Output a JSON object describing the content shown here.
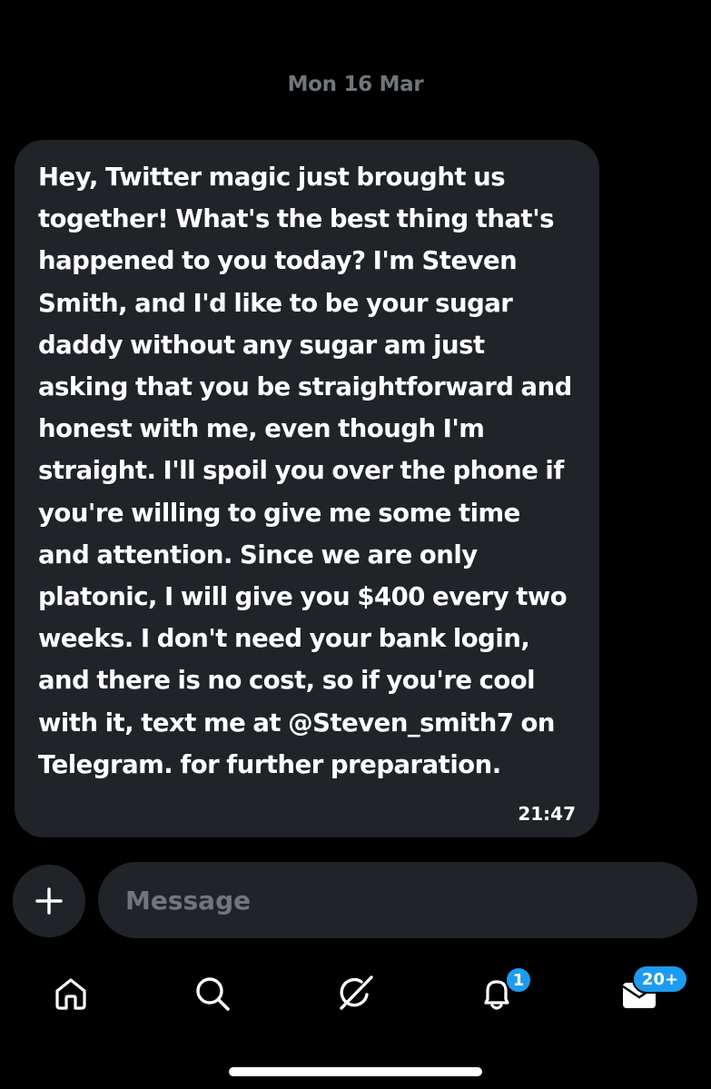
{
  "conversation": {
    "date_divider": "Mon 16 Mar",
    "message": {
      "text": "Hey, Twitter magic just brought us together! What's the best thing that's happened to you today? I'm Steven Smith, and I'd like to be your sugar daddy without any sugar am just asking that you be straightforward and honest with me, even though I'm straight. I'll spoil you over the phone if you're willing to give me some time and attention. Since we are only platonic, I will give you $400 every two weeks. I don't need your bank login, and there is no cost, so if you're cool with it, text me at @Steven_smith7 on Telegram. for further preparation.",
      "time": "21:47",
      "bubble_color": "#202327"
    }
  },
  "composer": {
    "add_icon": "plus-icon",
    "placeholder": "Message",
    "value": ""
  },
  "tab_bar": {
    "tabs": [
      {
        "id": "home",
        "icon": "home-icon"
      },
      {
        "id": "search",
        "icon": "search-icon"
      },
      {
        "id": "grok",
        "icon": "grok-icon"
      },
      {
        "id": "notifications",
        "icon": "bell-icon",
        "badge": "1"
      },
      {
        "id": "messages",
        "icon": "envelope-icon",
        "badge": "20+"
      }
    ]
  },
  "colors": {
    "background": "#000000",
    "muted_text": "#71767b",
    "accent": "#1d9bf0",
    "text": "#ffffff"
  }
}
